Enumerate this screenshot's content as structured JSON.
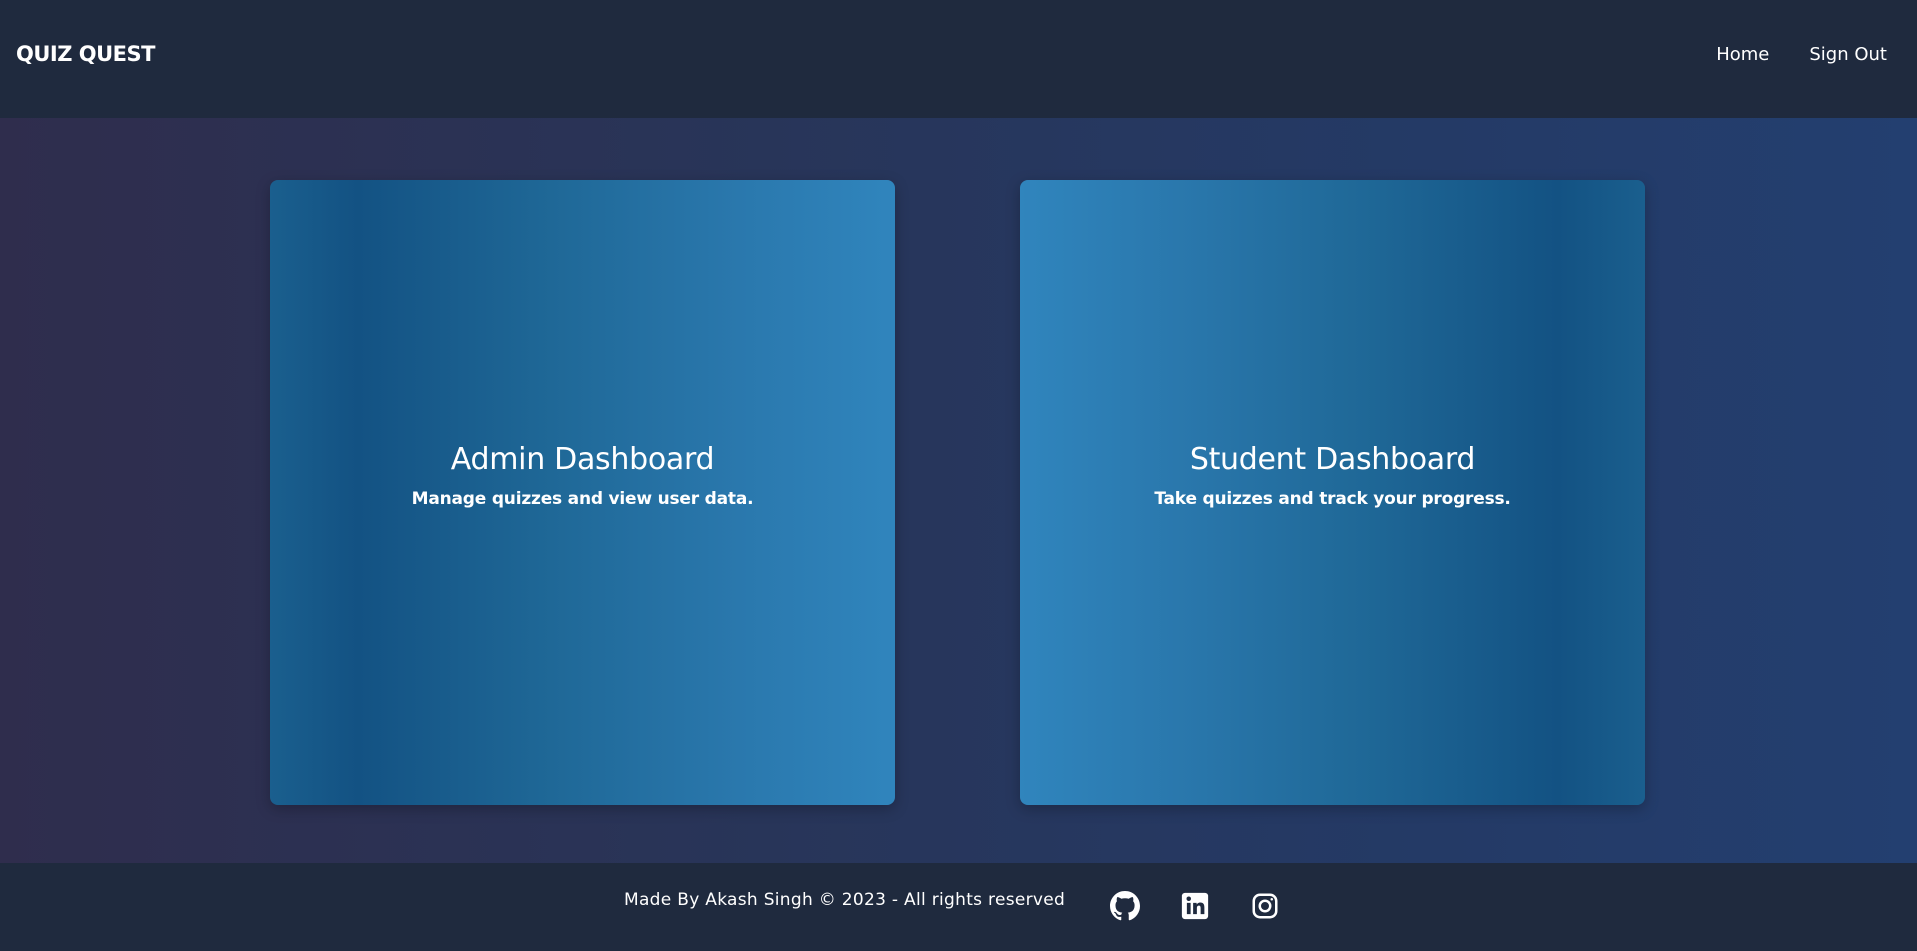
{
  "navbar": {
    "brand": "QUIZ QUEST",
    "links": [
      {
        "label": "Home"
      },
      {
        "label": "Sign Out"
      }
    ]
  },
  "cards": [
    {
      "title": "Admin Dashboard",
      "description": "Manage quizzes and view user data."
    },
    {
      "title": "Student Dashboard",
      "description": "Take quizzes and track your progress."
    }
  ],
  "footer": {
    "text": "Made By Akash Singh © 2023 - All rights reserved",
    "social_icons": [
      "github-icon",
      "linkedin-icon",
      "instagram-icon"
    ]
  },
  "colors": {
    "navbar_bg": "#1f2a3e",
    "footer_bg": "#1f2a3e",
    "card_accent_light": "#3085bd",
    "card_accent_dark": "#135283"
  }
}
